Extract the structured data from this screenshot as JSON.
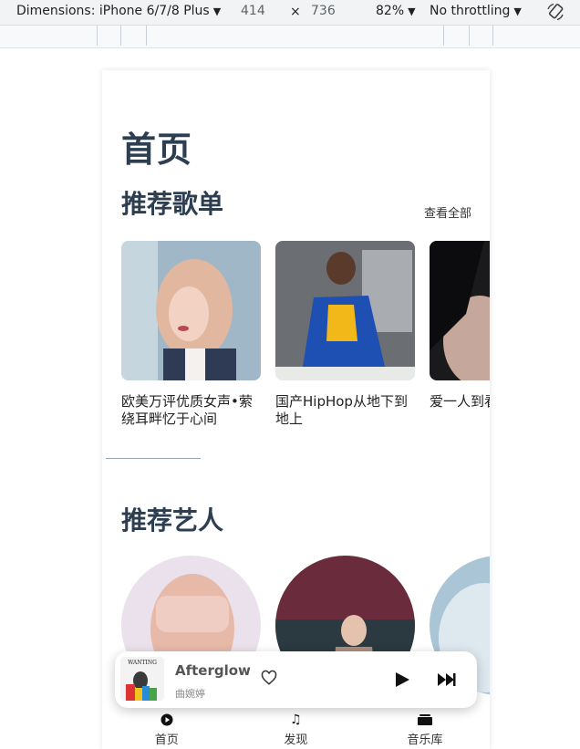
{
  "devtools": {
    "device_label": "Dimensions: iPhone 6/7/8 Plus",
    "width": "414",
    "times": "×",
    "height": "736",
    "zoom": "82%",
    "throttle": "No throttling"
  },
  "page": {
    "title": "首页",
    "recommended_playlists": {
      "heading": "推荐歌单",
      "see_all": "查看全部",
      "items": [
        {
          "title": "欧美万评优质女声•萦绕耳畔忆于心间"
        },
        {
          "title": "国产HipHop从地下到地上"
        },
        {
          "title": "爱一人到看一次就"
        }
      ]
    },
    "recommended_artists": {
      "heading": "推荐艺人"
    }
  },
  "player": {
    "song": "Afterglow",
    "artist": "曲婉婷",
    "album_art_text": "WANTING",
    "favorite_icon": "heart-outline-icon",
    "play_icon": "play-icon",
    "next_icon": "skip-next-icon"
  },
  "tabbar": {
    "items": [
      {
        "label": "首页",
        "icon": "play-circle-icon"
      },
      {
        "label": "发现",
        "icon": "music-note-icon"
      },
      {
        "label": "音乐库",
        "icon": "library-icon"
      }
    ]
  },
  "colors": {
    "heading": "#2c3e50",
    "devtools_bg": "#f1f3f4"
  }
}
